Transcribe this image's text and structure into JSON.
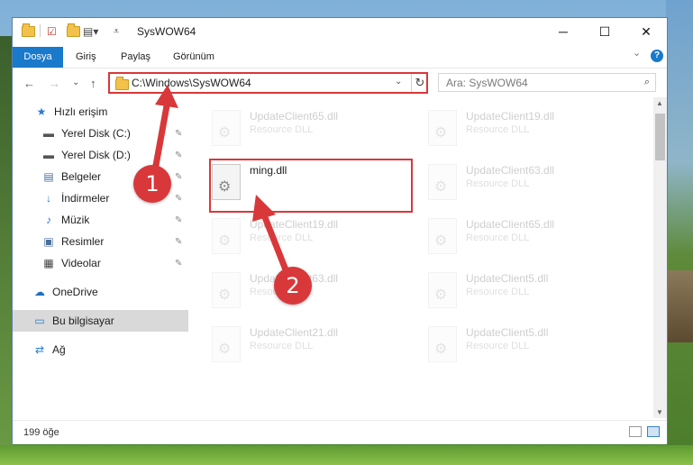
{
  "window": {
    "title": "SysWOW64",
    "controls": {
      "minimize": "─",
      "maximize": "☐",
      "close": "✕"
    }
  },
  "ribbon": {
    "tabs": [
      "Dosya",
      "Giriş",
      "Paylaş",
      "Görünüm"
    ],
    "expand": "⌄",
    "help": "?"
  },
  "navigation": {
    "back": "←",
    "forward": "→",
    "recent": "⌄",
    "up": "↑",
    "address": "C:\\Windows\\SysWOW64",
    "address_dropdown": "⌄",
    "refresh": "↻",
    "search_placeholder": "Ara: SysWOW64",
    "search_icon": "⌕"
  },
  "sidebar": {
    "items": [
      {
        "label": "Hızlı erişim",
        "icon": "star-icon",
        "glyph": "★",
        "pinned": false
      },
      {
        "label": "Yerel Disk (C:)",
        "icon": "drive-icon",
        "glyph": "▬",
        "pinned": true
      },
      {
        "label": "Yerel Disk (D:)",
        "icon": "drive-icon",
        "glyph": "▬",
        "pinned": true
      },
      {
        "label": "Belgeler",
        "icon": "documents-icon",
        "glyph": "▤",
        "pinned": true
      },
      {
        "label": "İndirmeler",
        "icon": "download-icon",
        "glyph": "↓",
        "pinned": true
      },
      {
        "label": "Müzik",
        "icon": "music-icon",
        "glyph": "♪",
        "pinned": true
      },
      {
        "label": "Resimler",
        "icon": "pictures-icon",
        "glyph": "▣",
        "pinned": true
      },
      {
        "label": "Videolar",
        "icon": "video-icon",
        "glyph": "▦",
        "pinned": true
      },
      {
        "label": "OneDrive",
        "icon": "cloud-icon",
        "glyph": "☁",
        "pinned": false
      },
      {
        "label": "Bu bilgisayar",
        "icon": "computer-icon",
        "glyph": "▭",
        "pinned": false,
        "selected": true
      },
      {
        "label": "Ağ",
        "icon": "network-icon",
        "glyph": "⇄",
        "pinned": false
      }
    ],
    "pin_glyph": "📌"
  },
  "files": [
    {
      "name": "UpdateClient65.dll",
      "type": "Resource DLL",
      "faded": true
    },
    {
      "name": "UpdateClient19.dll",
      "type": "Resource DLL",
      "faded": true
    },
    {
      "name": "ming.dll",
      "type": "",
      "faded": false
    },
    {
      "name": "UpdateClient63.dll",
      "type": "Resource DLL",
      "faded": true
    },
    {
      "name": "UpdateClient19.dll",
      "type": "Resource DLL",
      "faded": true
    },
    {
      "name": "UpdateClient65.dll",
      "type": "Resource DLL",
      "faded": true
    },
    {
      "name": "UpdateClient63.dll",
      "type": "Resource DLL",
      "faded": true
    },
    {
      "name": "UpdateClient5.dll",
      "type": "Resource DLL",
      "faded": true
    },
    {
      "name": "UpdateClient21.dll",
      "type": "Resource DLL",
      "faded": true
    },
    {
      "name": "UpdateClient5.dll",
      "type": "Resource DLL",
      "faded": true
    }
  ],
  "status": {
    "count": "199 öğe"
  },
  "callouts": [
    "1",
    "2"
  ],
  "colors": {
    "accent": "#1979ca",
    "annotation": "#d9383a"
  }
}
